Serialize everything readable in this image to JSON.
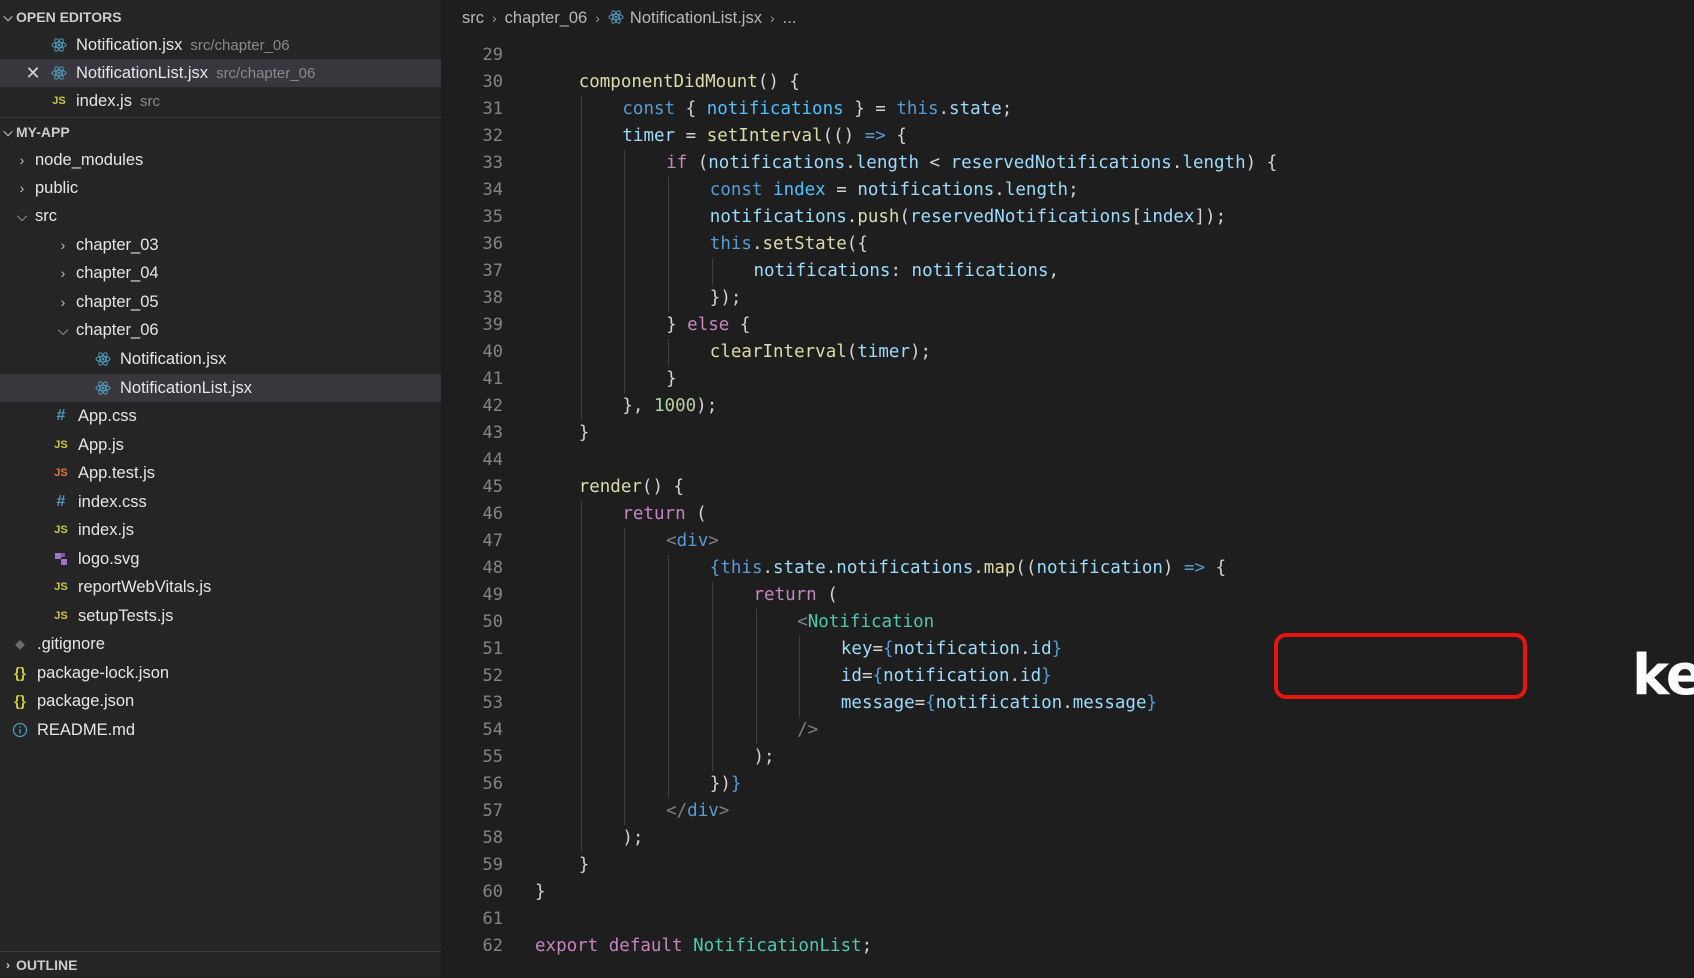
{
  "sidebar": {
    "open_editors": {
      "title": "OPEN EDITORS",
      "items": [
        {
          "label": "Notification.jsx",
          "description": "src/chapter_06",
          "icon": "react-icon"
        },
        {
          "label": "NotificationList.jsx",
          "description": "src/chapter_06",
          "icon": "react-icon",
          "active": true,
          "close": "✕"
        },
        {
          "label": "index.js",
          "description": "src",
          "icon": "js-icon"
        }
      ]
    },
    "project": {
      "title": "MY-APP",
      "items": [
        {
          "label": "node_modules",
          "kind": "folder"
        },
        {
          "label": "public",
          "kind": "folder"
        },
        {
          "label": "src",
          "kind": "folder-open"
        },
        {
          "label": "chapter_03",
          "kind": "folder"
        },
        {
          "label": "chapter_04",
          "kind": "folder"
        },
        {
          "label": "chapter_05",
          "kind": "folder"
        },
        {
          "label": "chapter_06",
          "kind": "folder-open"
        },
        {
          "label": "Notification.jsx",
          "kind": "react-icon"
        },
        {
          "label": "NotificationList.jsx",
          "kind": "react-icon",
          "selected": true
        },
        {
          "label": "App.css",
          "kind": "css-icon"
        },
        {
          "label": "App.js",
          "kind": "js-icon"
        },
        {
          "label": "App.test.js",
          "kind": "js-icon"
        },
        {
          "label": "index.css",
          "kind": "css-icon"
        },
        {
          "label": "index.js",
          "kind": "js-icon"
        },
        {
          "label": "logo.svg",
          "kind": "svg-icon"
        },
        {
          "label": "reportWebVitals.js",
          "kind": "js-icon"
        },
        {
          "label": "setupTests.js",
          "kind": "js-icon"
        },
        {
          "label": ".gitignore",
          "kind": "git-icon"
        },
        {
          "label": "package-lock.json",
          "kind": "json-icon"
        },
        {
          "label": "package.json",
          "kind": "json-icon"
        },
        {
          "label": "README.md",
          "kind": "info-icon"
        }
      ]
    },
    "outline": {
      "title": "OUTLINE"
    }
  },
  "editor": {
    "breadcrumb": [
      "src",
      "chapter_06",
      "NotificationList.jsx",
      "..."
    ],
    "line_numbers": [
      "29",
      "30",
      "31",
      "32",
      "33",
      "34",
      "35",
      "36",
      "37",
      "38",
      "39",
      "40",
      "41",
      "42",
      "43",
      "44",
      "45",
      "46",
      "47",
      "48",
      "49",
      "50",
      "51",
      "52",
      "53",
      "54",
      "55",
      "56",
      "57",
      "58",
      "59",
      "60",
      "61",
      "62"
    ],
    "annotation": "key, id 추가하기!"
  },
  "colors": {
    "background": "#1e1e1e",
    "sidebar": "#252526",
    "highlight_box": "#e8150c",
    "annotation_text": "#ffffff"
  }
}
